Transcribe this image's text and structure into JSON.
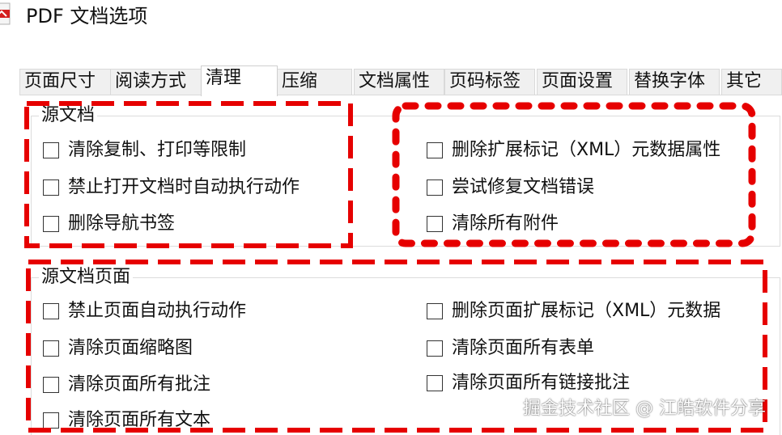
{
  "window": {
    "title": "PDF 文档选项"
  },
  "tabs": [
    {
      "label": "页面尺寸",
      "active": false
    },
    {
      "label": "阅读方式",
      "active": false
    },
    {
      "label": "清理",
      "active": true
    },
    {
      "label": "压缩",
      "active": false
    },
    {
      "label": "文档属性",
      "active": false
    },
    {
      "label": "页码标签",
      "active": false
    },
    {
      "label": "页面设置",
      "active": false
    },
    {
      "label": "替换字体",
      "active": false
    },
    {
      "label": "其它",
      "active": false
    }
  ],
  "source_document": {
    "title": "源文档",
    "options": [
      {
        "label": "清除复制、打印等限制",
        "checked": false
      },
      {
        "label": "禁止打开文档时自动执行动作",
        "checked": false
      },
      {
        "label": "删除导航书签",
        "checked": false
      },
      {
        "label": "删除扩展标记（XML）元数据属性",
        "checked": false
      },
      {
        "label": "尝试修复文档错误",
        "checked": false
      },
      {
        "label": "清除所有附件",
        "checked": false
      }
    ]
  },
  "source_pages": {
    "title": "源文档页面",
    "options": [
      {
        "label": "禁止页面自动执行动作",
        "checked": false
      },
      {
        "label": "清除页面缩略图",
        "checked": false
      },
      {
        "label": "清除页面所有批注",
        "checked": false
      },
      {
        "label": "清除页面所有文本",
        "checked": false
      },
      {
        "label": "删除页面扩展标记（XML）元数据",
        "checked": false
      },
      {
        "label": "清除页面所有表单",
        "checked": false
      },
      {
        "label": "清除页面所有链接批注",
        "checked": false
      }
    ]
  },
  "annotation_color": "#e60000",
  "watermark": "掘金技术社区 @ 江皓软件分享"
}
